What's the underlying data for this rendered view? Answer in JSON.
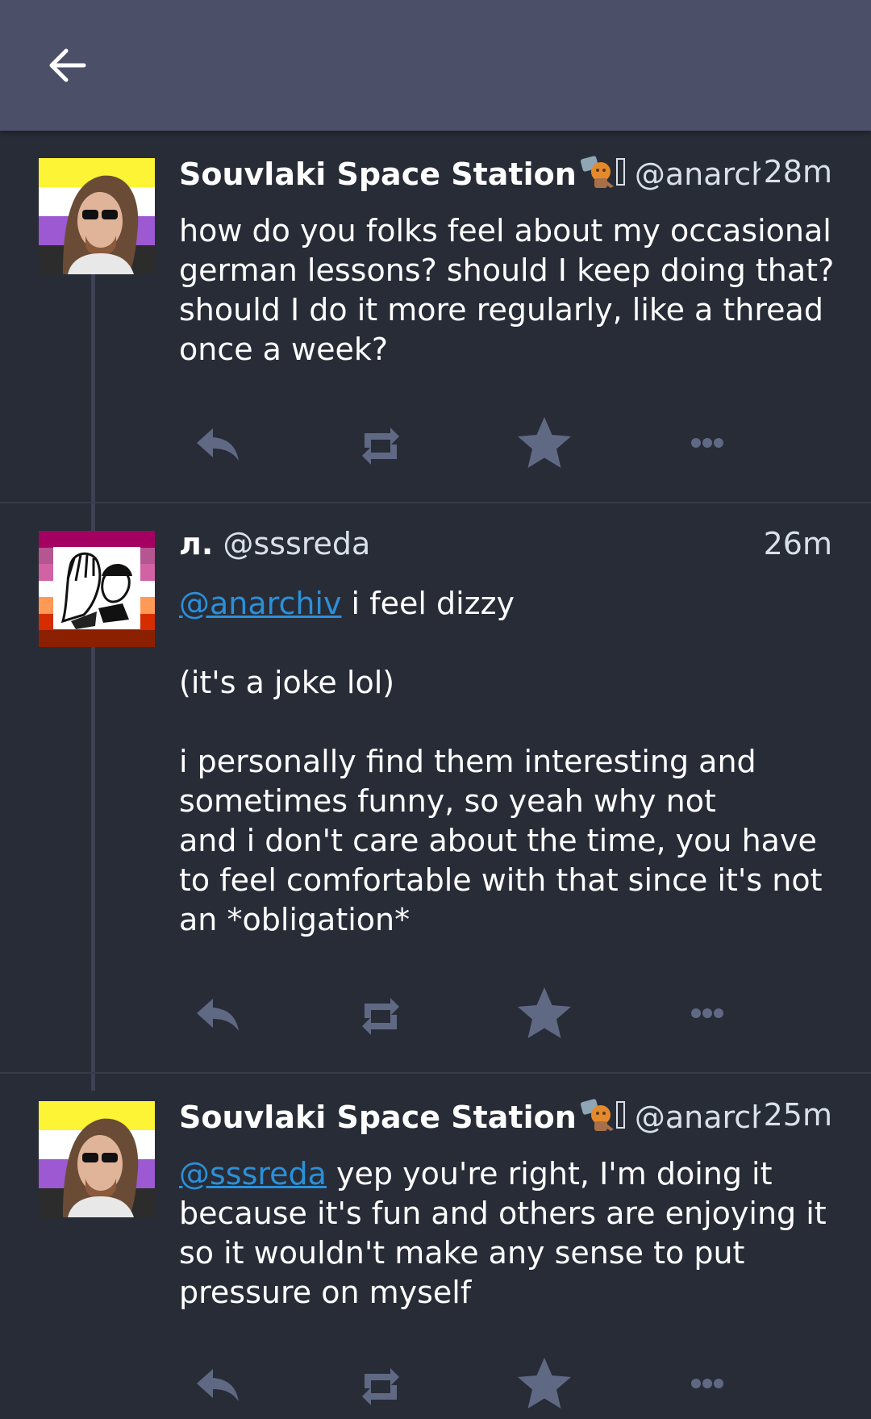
{
  "header": {
    "back_icon": "arrow-left-icon"
  },
  "colors": {
    "background": "#282c37",
    "topbar": "#4b5068",
    "action_icon": "#606984",
    "mention": "#2b90d9",
    "secondary_text": "#d9e1e8"
  },
  "statuses": [
    {
      "display_name": "Souvlaki Space Station",
      "handle": "@anarchi…",
      "time": "28m",
      "emoji_name": "custom-emoji",
      "avatar": "nonbinary-flag-avatar",
      "paragraphs": [
        "how do you folks feel about my occasional german lessons? should I keep doing that? should I do it more regularly, like a thread once a week?"
      ]
    },
    {
      "display_name": "л.",
      "handle": "@sssreda",
      "time": "26m",
      "avatar": "lesbian-flag-avatar",
      "mention": "@anarchiv",
      "first_line_rest": " i feel dizzy",
      "paragraph_2": "(it's a joke lol)",
      "paragraph_3_lines": [
        "i personally find them interesting and sometimes funny, so yeah why not",
        "and i don't care about the time, you have to feel comfortable with that since it's not an *obligation*"
      ]
    },
    {
      "display_name": "Souvlaki Space Station",
      "handle": "@anarchi…",
      "time": "25m",
      "emoji_name": "custom-emoji",
      "avatar": "nonbinary-flag-avatar",
      "mention": "@sssreda",
      "text_rest": " yep you're right, I'm doing it because it's fun and others are enjoying it so it wouldn't make any sense to put pressure on myself"
    }
  ],
  "actions": {
    "reply_icon": "reply-icon",
    "boost_icon": "boost-icon",
    "favourite_icon": "star-icon",
    "more_icon": "more-icon"
  }
}
